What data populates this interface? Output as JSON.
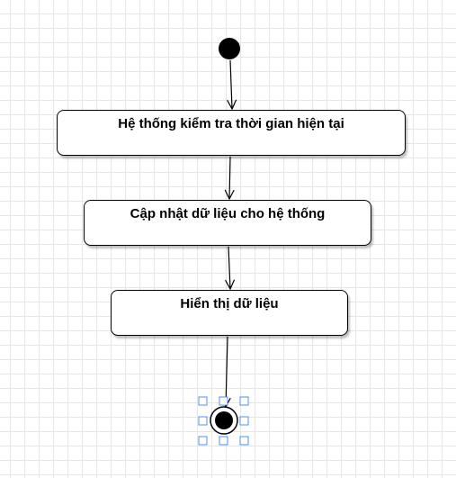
{
  "diagram": {
    "nodes": [
      {
        "id": "initial",
        "type": "initial"
      },
      {
        "id": "n1",
        "type": "action",
        "label": "Hệ thống kiểm tra thời gian hiện tại"
      },
      {
        "id": "n2",
        "type": "action",
        "label": "Cập nhật dữ liệu cho hệ thống"
      },
      {
        "id": "n3",
        "type": "action",
        "label": "Hiển thị dữ liệu"
      },
      {
        "id": "final",
        "type": "final",
        "selected": true
      }
    ],
    "edges": [
      {
        "from": "initial",
        "to": "n1"
      },
      {
        "from": "n1",
        "to": "n2"
      },
      {
        "from": "n2",
        "to": "n3"
      },
      {
        "from": "n3",
        "to": "final"
      }
    ],
    "colors": {
      "stroke": "#000000",
      "selection": "#2b7de9",
      "grid": "#e6e6e6"
    }
  }
}
